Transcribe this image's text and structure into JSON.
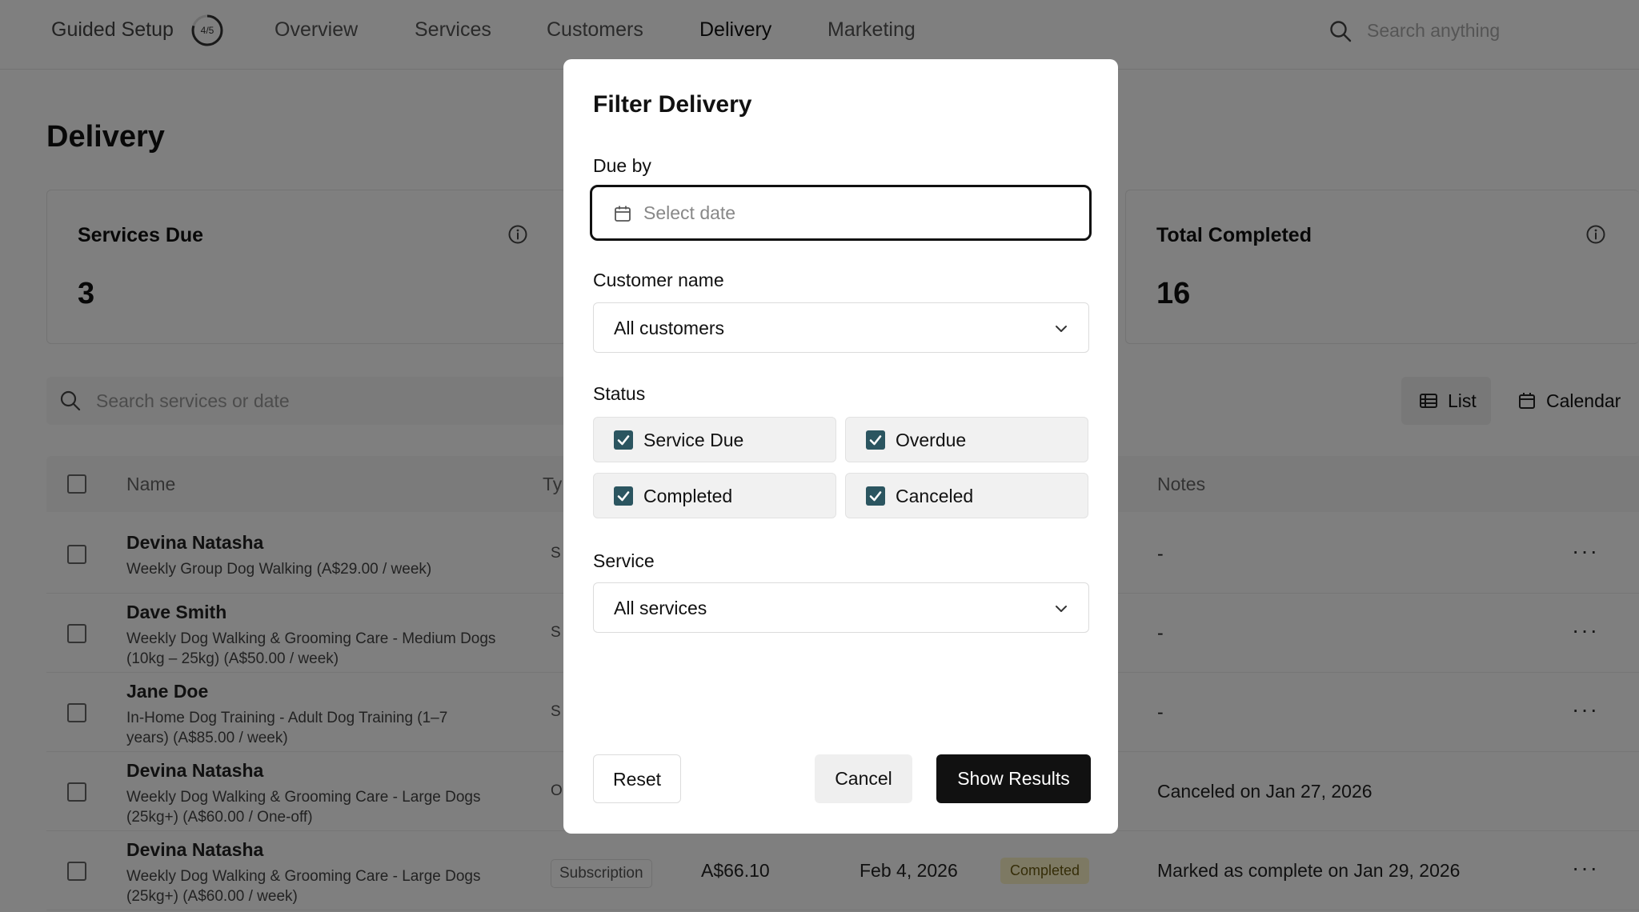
{
  "topnav": {
    "guided_setup": "Guided Setup",
    "progress": "4/5",
    "items": [
      "Overview",
      "Services",
      "Customers",
      "Delivery",
      "Marketing"
    ],
    "active": "Delivery",
    "search_placeholder": "Search anything"
  },
  "page": {
    "title": "Delivery"
  },
  "cards": [
    {
      "title": "Services Due",
      "value": "3"
    },
    {
      "title": "Total Completed",
      "value": "16"
    }
  ],
  "toolbar": {
    "search_placeholder": "Search services or date",
    "list_label": "List",
    "calendar_label": "Calendar"
  },
  "table": {
    "headers": {
      "name": "Name",
      "type": "Ty",
      "notes": "Notes"
    },
    "rows": [
      {
        "name": "Devina Natasha",
        "desc": "Weekly Group Dog Walking (A$29.00 / week)",
        "type": "S",
        "price": "",
        "date": "",
        "status": "",
        "notes": "-"
      },
      {
        "name": "Dave Smith",
        "desc": "Weekly Dog Walking & Grooming Care - Medium Dogs (10kg – 25kg) (A$50.00 / week)",
        "type": "S",
        "price": "",
        "date": "",
        "status": "",
        "notes": "-"
      },
      {
        "name": "Jane Doe",
        "desc": "In-Home Dog Training - Adult Dog Training (1–7 years) (A$85.00 / week)",
        "type": "S",
        "price": "",
        "date": "",
        "status": "",
        "notes": "-"
      },
      {
        "name": "Devina Natasha",
        "desc": "Weekly Dog Walking & Grooming Care - Large Dogs (25kg+) (A$60.00 / One-off)",
        "type": "O",
        "price": "",
        "date": "",
        "status": "",
        "notes": "Canceled on Jan 27, 2026"
      },
      {
        "name": "Devina Natasha",
        "desc": "Weekly Dog Walking & Grooming Care - Large Dogs (25kg+) (A$60.00 / week)",
        "type": "Subscription",
        "price": "A$66.10",
        "date": "Feb 4, 2026",
        "status": "Completed",
        "notes": "Marked as complete on Jan 29, 2026"
      }
    ],
    "more": "···"
  },
  "modal": {
    "title": "Filter Delivery",
    "due_by_label": "Due by",
    "due_by_placeholder": "Select date",
    "customer_label": "Customer name",
    "customer_value": "All customers",
    "status_label": "Status",
    "statuses": [
      {
        "label": "Service Due",
        "checked": true
      },
      {
        "label": "Overdue",
        "checked": true
      },
      {
        "label": "Completed",
        "checked": true
      },
      {
        "label": "Canceled",
        "checked": true
      }
    ],
    "service_label": "Service",
    "service_value": "All services",
    "reset_label": "Reset",
    "cancel_label": "Cancel",
    "show_results_label": "Show Results"
  },
  "colors": {
    "overlay": "#000000",
    "checkbox_checked": "#2b5560",
    "primary_button": "#111111",
    "status_completed_bg": "#fbf3c6"
  }
}
